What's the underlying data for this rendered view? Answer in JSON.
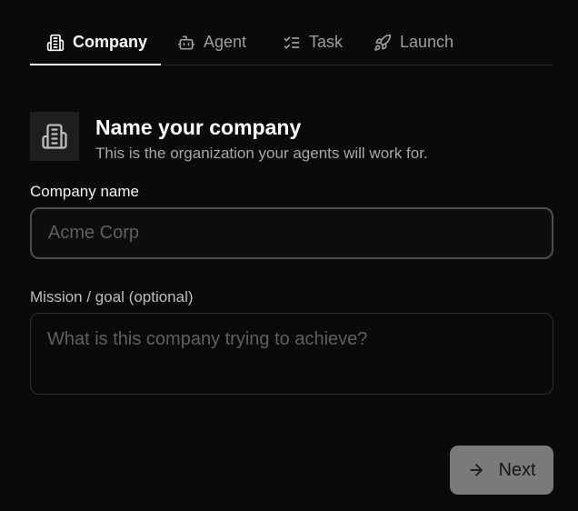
{
  "tabs": [
    {
      "label": "Company",
      "icon": "building-icon",
      "active": true
    },
    {
      "label": "Agent",
      "icon": "bot-icon",
      "active": false
    },
    {
      "label": "Task",
      "icon": "list-checks-icon",
      "active": false
    },
    {
      "label": "Launch",
      "icon": "rocket-icon",
      "active": false
    }
  ],
  "header": {
    "icon": "building-icon",
    "title": "Name your company",
    "subtitle": "This is the organization your agents will work for."
  },
  "form": {
    "company_name": {
      "label": "Company name",
      "value": "",
      "placeholder": "Acme Corp"
    },
    "mission": {
      "label": "Mission / goal (optional)",
      "value": "",
      "placeholder": "What is this company trying to achieve?"
    }
  },
  "actions": {
    "next_label": "Next",
    "next_icon": "arrow-right-icon"
  },
  "colors": {
    "background": "#0a0a0a",
    "active_tab": "#ffffff",
    "inactive_tab": "#9d9d9d",
    "button_bg": "#7a7a7a"
  }
}
